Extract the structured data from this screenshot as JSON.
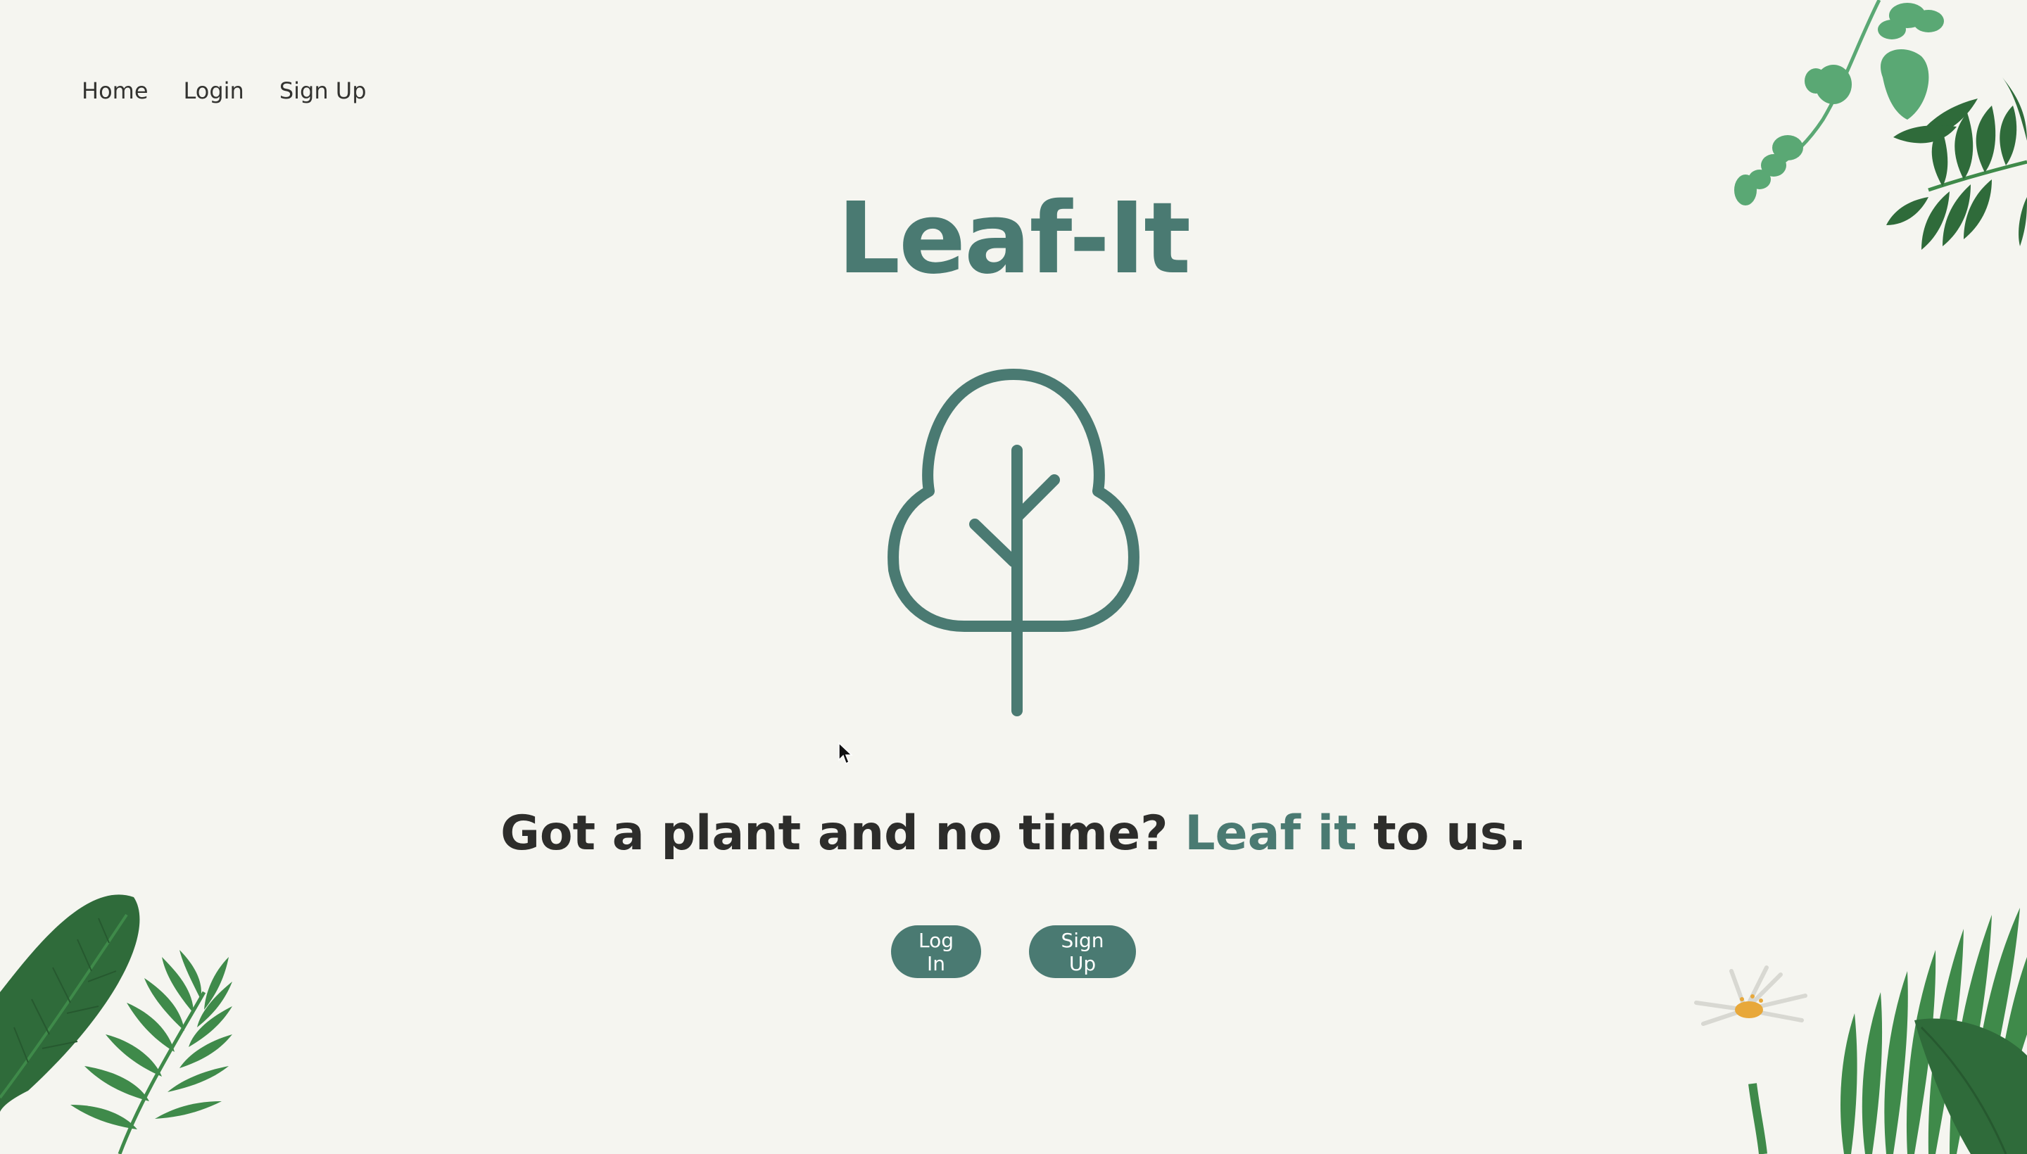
{
  "nav": {
    "items": [
      {
        "label": "Home"
      },
      {
        "label": "Login"
      },
      {
        "label": "Sign Up"
      }
    ]
  },
  "hero": {
    "title": "Leaf-It",
    "logo_icon": "tree-icon",
    "tagline_part1": "Got a plant and no time? ",
    "tagline_accent": "Leaf it",
    "tagline_part2": " to us.",
    "login_button": "Log In",
    "signup_button": "Sign Up"
  },
  "colors": {
    "accent": "#4a7a72",
    "background": "#f5f5f0",
    "text": "#2d2d2b",
    "leaf_dark": "#2f6b3a",
    "leaf_mid": "#3f8a4a",
    "leaf_light": "#5aa874"
  }
}
